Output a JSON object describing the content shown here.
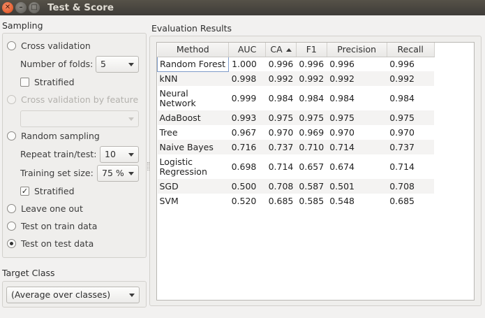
{
  "window": {
    "title": "Test & Score"
  },
  "sampling": {
    "title": "Sampling",
    "cross_validation": {
      "label": "Cross validation",
      "folds_label": "Number of folds:",
      "folds_value": "5",
      "stratified_label": "Stratified",
      "stratified_checked": false
    },
    "cv_by_feature": {
      "label": "Cross validation by feature",
      "value": ""
    },
    "random_sampling": {
      "label": "Random sampling",
      "repeat_label": "Repeat train/test:",
      "repeat_value": "10",
      "size_label": "Training set size:",
      "size_value": "75 %",
      "stratified_label": "Stratified",
      "stratified_checked": true,
      "check_glyph": "✓"
    },
    "leave_one_out": {
      "label": "Leave one out"
    },
    "test_on_train": {
      "label": "Test on train data"
    },
    "test_on_test": {
      "label": "Test on test data",
      "selected": true
    }
  },
  "target_class": {
    "title": "Target Class",
    "value": "(Average over classes)"
  },
  "results": {
    "title": "Evaluation Results",
    "columns": [
      "Method",
      "AUC",
      "CA",
      "F1",
      "Precision",
      "Recall"
    ],
    "sorted_column": "CA",
    "rows": [
      {
        "method": "Random Forest",
        "auc": "1.000",
        "ca": "0.996",
        "f1": "0.996",
        "precision": "0.996",
        "recall": "0.996"
      },
      {
        "method": "kNN",
        "auc": "0.998",
        "ca": "0.992",
        "f1": "0.992",
        "precision": "0.992",
        "recall": "0.992"
      },
      {
        "method": "Neural Network",
        "auc": "0.999",
        "ca": "0.984",
        "f1": "0.984",
        "precision": "0.984",
        "recall": "0.984"
      },
      {
        "method": "AdaBoost",
        "auc": "0.993",
        "ca": "0.975",
        "f1": "0.975",
        "precision": "0.975",
        "recall": "0.975"
      },
      {
        "method": "Tree",
        "auc": "0.967",
        "ca": "0.970",
        "f1": "0.969",
        "precision": "0.970",
        "recall": "0.970"
      },
      {
        "method": "Naive Bayes",
        "auc": "0.716",
        "ca": "0.737",
        "f1": "0.710",
        "precision": "0.714",
        "recall": "0.737"
      },
      {
        "method": "Logistic Regression",
        "auc": "0.698",
        "ca": "0.714",
        "f1": "0.657",
        "precision": "0.674",
        "recall": "0.714"
      },
      {
        "method": "SGD",
        "auc": "0.500",
        "ca": "0.708",
        "f1": "0.587",
        "precision": "0.501",
        "recall": "0.708"
      },
      {
        "method": "SVM",
        "auc": "0.520",
        "ca": "0.685",
        "f1": "0.585",
        "precision": "0.548",
        "recall": "0.685"
      }
    ]
  },
  "icons": {
    "close": "close-icon",
    "minimize": "minimize-icon",
    "maximize": "maximize-icon"
  },
  "colors": {
    "titlebar": "#3e3c38",
    "close_button": "#df4a16",
    "background": "#f2f1f0",
    "selection_border": "#7f9cc9"
  }
}
